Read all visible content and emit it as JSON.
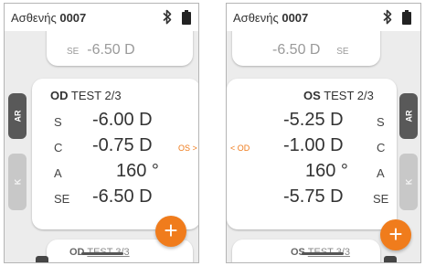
{
  "left": {
    "header": {
      "title_prefix": "Ασθενής",
      "patient_id": "0007"
    },
    "top_card": {
      "label": "SE",
      "value": "-6.50 D"
    },
    "main_card": {
      "eye": "OD",
      "test_label": "TEST 2/3",
      "rows": [
        {
          "label": "S",
          "value": "-6.00 D"
        },
        {
          "label": "C",
          "value": "-0.75 D"
        },
        {
          "label": "A",
          "value": "160 °"
        },
        {
          "label": "SE",
          "value": "-6.50 D"
        }
      ]
    },
    "side_tabs": {
      "ar": "AR",
      "k": "K"
    },
    "swap_link": "OS >",
    "bottom_card": {
      "eye": "OD",
      "test_label": "TEST 3/3"
    },
    "fab_label": "+"
  },
  "right": {
    "header": {
      "title_prefix": "Ασθενής",
      "patient_id": "0007"
    },
    "top_card": {
      "label": "SE",
      "value": "-6.50 D"
    },
    "main_card": {
      "eye": "OS",
      "test_label": "TEST 2/3",
      "rows": [
        {
          "label": "S",
          "value": "-5.25 D"
        },
        {
          "label": "C",
          "value": "-1.00 D"
        },
        {
          "label": "A",
          "value": "160 °"
        },
        {
          "label": "SE",
          "value": "-5.75 D"
        }
      ]
    },
    "side_tabs": {
      "ar": "AR",
      "k": "K"
    },
    "swap_link": "< OD",
    "bottom_card": {
      "eye": "OS",
      "test_label": "TEST 3/3"
    },
    "fab_label": "+"
  },
  "colors": {
    "accent": "#f07c1c",
    "tab_dark": "#595959",
    "tab_light": "#c8c8c8"
  }
}
